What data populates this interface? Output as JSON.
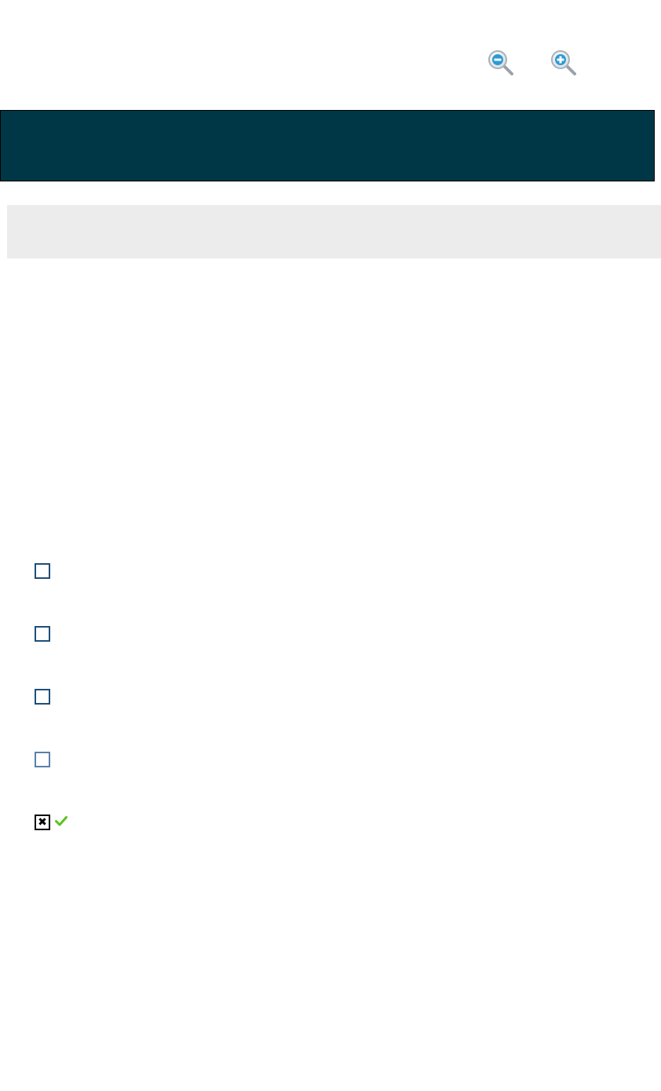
{
  "toolbar": {
    "zoom_out_icon": "zoom-out-icon",
    "zoom_in_icon": "zoom-in-icon"
  },
  "header": {
    "title": "",
    "background_color": "#003747"
  },
  "subheader": {
    "text": "",
    "background_color": "#ececec"
  },
  "question": {
    "options": [
      {
        "label": "",
        "checked": false
      },
      {
        "label": "",
        "checked": false
      },
      {
        "label": "",
        "checked": false
      },
      {
        "label": "",
        "checked": false
      },
      {
        "label": "",
        "checked": true,
        "checked_glyph": "✖",
        "marked_correct": true
      }
    ],
    "correct_indicator_icon": "checkmark-icon",
    "correct_indicator_color": "#5cc21a"
  }
}
